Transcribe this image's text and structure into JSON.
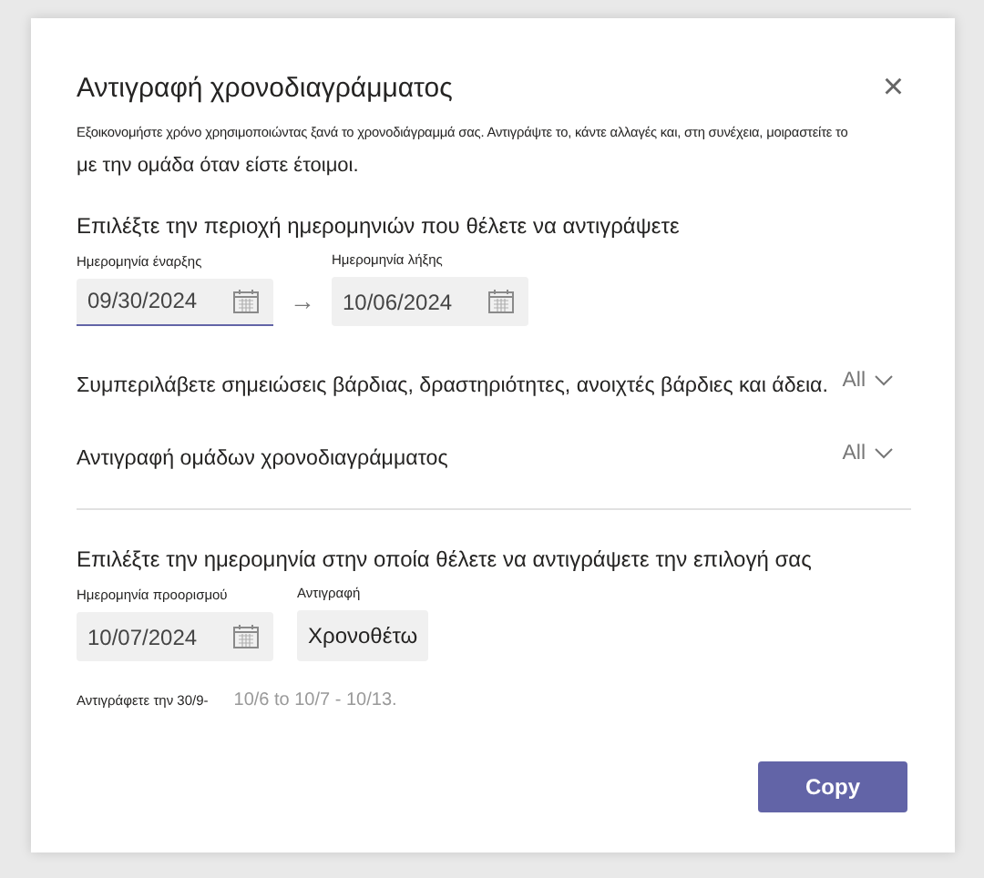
{
  "dialog": {
    "title": "Αντιγραφή χρονοδιαγράμματος",
    "close": "×",
    "intro_line_1": "Εξοικονομήστε χρόνο χρησιμοποιώντας ξανά το χρονοδιάγραμμά σας. Αντιγράψτε το, κάντε αλλαγές και, στη συνέχεια, μοιραστείτε το",
    "intro_line_2": "με την ομάδα όταν είστε έτοιμοι."
  },
  "range": {
    "heading": "Επιλέξτε την περιοχή ημερομηνιών που θέλετε να αντιγράψετε",
    "arrow": "→",
    "fields": [
      {
        "label": "Ημερομηνία έναρξης",
        "value": "09/30/2024",
        "focused": true
      },
      {
        "label": "Ημερομηνία λήξης",
        "value": "10/06/2024",
        "focused": false
      }
    ]
  },
  "options": [
    {
      "label": "Συμπεριλάβετε σημειώσεις βάρδιας, δραστηριότητες, ανοιχτές βάρδιες και άδεια.",
      "value": "All"
    },
    {
      "label": "Αντιγραφή ομάδων χρονοδιαγράμματος",
      "value": "All"
    }
  ],
  "destination": {
    "heading": "Επιλέξτε την ημερομηνία στην οποία θέλετε να αντιγράψετε την επιλογή σας",
    "date_label": "Ημερομηνία προορισμού",
    "date_value": "10/07/2024",
    "copy_label": "Αντιγραφή",
    "copy_value": "Χρονοθέτω",
    "summary_prefix": "Αντιγράφετε την 30/9-",
    "summary_rest": "10/6 to 10/7 - 10/13."
  },
  "buttons": [
    {
      "label": "Copy"
    }
  ]
}
